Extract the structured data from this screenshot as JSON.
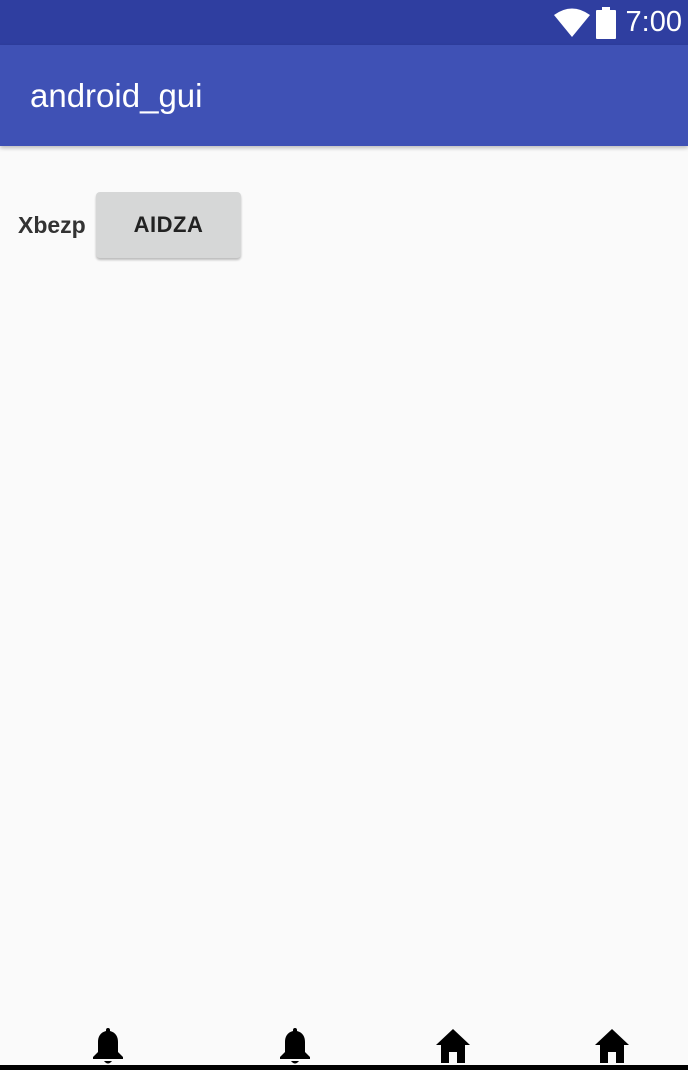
{
  "status_bar": {
    "time": "7:00",
    "icons": [
      "wifi-icon",
      "battery-icon"
    ],
    "color": "#2f3ea0"
  },
  "app_bar": {
    "title": "android_gui",
    "color": "#3f51b5"
  },
  "content": {
    "label": "Xbezp",
    "button_label": "AIDZA"
  },
  "bottom_nav": {
    "icons": [
      "bell-icon",
      "bell-icon",
      "home-icon",
      "home-icon"
    ]
  }
}
